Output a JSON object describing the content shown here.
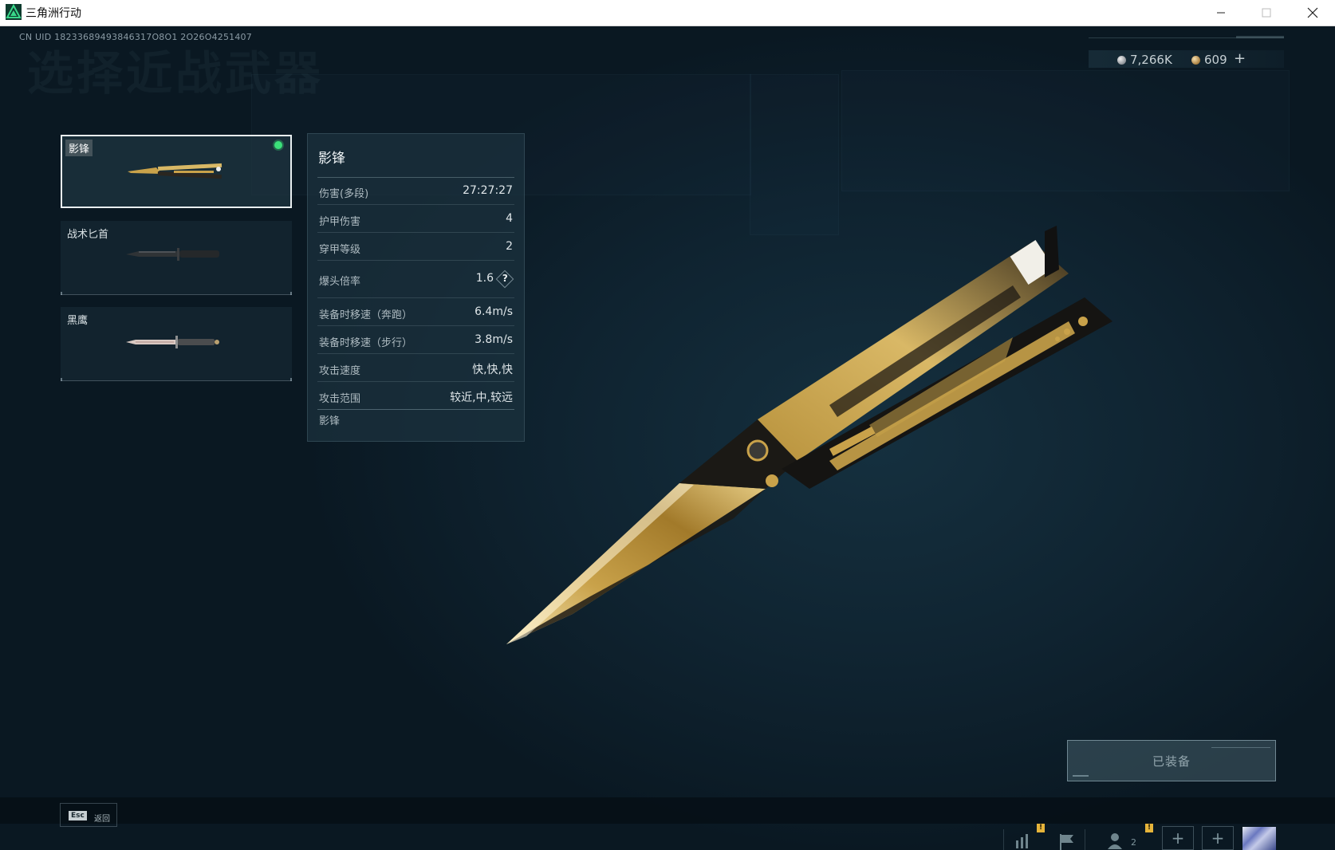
{
  "window": {
    "title": "三角洲行动",
    "controls": [
      "minimize",
      "maximize",
      "close"
    ]
  },
  "header": {
    "uid": "CN UID 18233689493846317O8O1 2O26O4251407",
    "ghost_title": "选择近战武器"
  },
  "currency": {
    "silver_value": "7,266K",
    "gold_value": "609",
    "add_label": "+",
    "silver_icon": "silver-coin-icon",
    "gold_icon": "gold-coin-icon"
  },
  "weapons": [
    {
      "name": "影锋",
      "selected": true,
      "equipped": true
    },
    {
      "name": "战术匕首",
      "selected": false,
      "equipped": false
    },
    {
      "name": "黑鹰",
      "selected": false,
      "equipped": false
    }
  ],
  "stats": {
    "title": "影锋",
    "rows": [
      {
        "label": "伤害(多段)",
        "value": "27:27:27"
      },
      {
        "label": "护甲伤害",
        "value": "4"
      },
      {
        "label": "穿甲等级",
        "value": "2"
      },
      {
        "label": "爆头倍率",
        "value": "1.6",
        "help": "?"
      },
      {
        "label": "装备时移速（奔跑）",
        "value": "6.4m/s"
      },
      {
        "label": "装备时移速（步行）",
        "value": "3.8m/s"
      },
      {
        "label": "攻击速度",
        "value": "快,快,快"
      },
      {
        "label": "攻击范围",
        "value": "较近,中,较远"
      }
    ],
    "description": "影锋"
  },
  "equip_button": {
    "label": "已装备"
  },
  "bottom_bar": {
    "esc_key": "Esc",
    "esc_label": "返回",
    "warn_badge": "!",
    "friend_count": "2",
    "plus_label": "+"
  },
  "colors": {
    "background": "#0b1a24",
    "equipped_dot": "#3be07a",
    "gold": "#c9a24a",
    "warn": "#e6b43a"
  }
}
